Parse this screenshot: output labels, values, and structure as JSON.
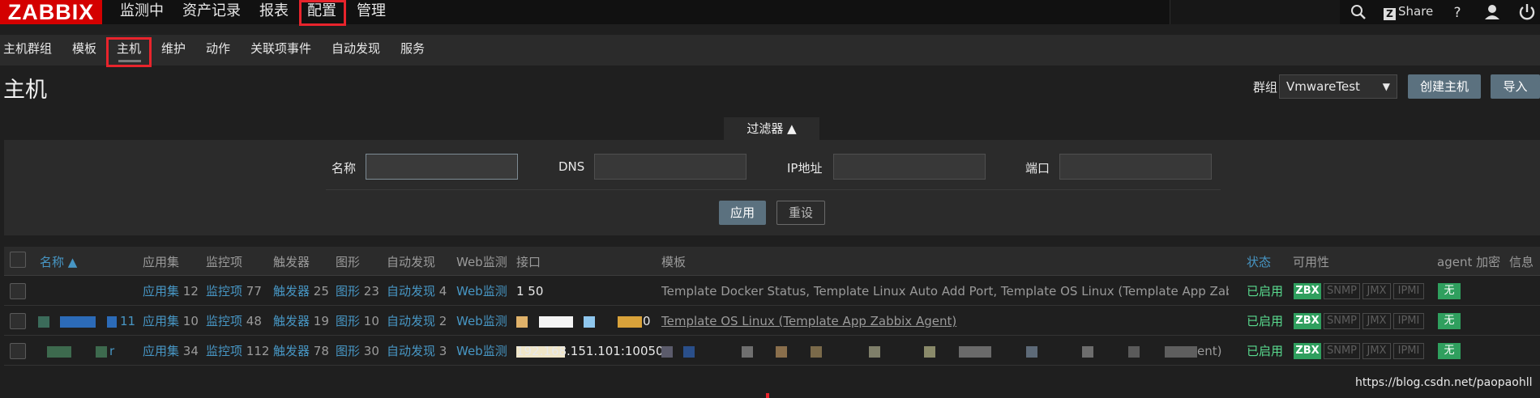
{
  "topbar": {
    "logo": "ZABBIX",
    "menu": [
      "监测中",
      "资产记录",
      "报表",
      "配置",
      "管理"
    ],
    "share_label": "Share",
    "share_box": "Z",
    "icons": [
      "search-icon",
      "help-icon",
      "user-icon",
      "power-icon"
    ]
  },
  "subnav": {
    "items": [
      "主机群组",
      "模板",
      "主机",
      "维护",
      "动作",
      "关联项事件",
      "自动发现",
      "服务"
    ]
  },
  "page": {
    "title": "主机",
    "group_label": "群组",
    "group_value": "VmwareTest",
    "create_button": "创建主机",
    "import_button": "导入"
  },
  "filter": {
    "tab_label": "过滤器 ▲",
    "name_label": "名称",
    "dns_label": "DNS",
    "ip_label": "IP地址",
    "port_label": "端口",
    "apply_button": "应用",
    "reset_button": "重设"
  },
  "table": {
    "headers": {
      "name": "名称 ▲",
      "apps": "应用集",
      "items": "监控项",
      "triggers": "触发器",
      "graphs": "图形",
      "discovery": "自动发现",
      "web": "Web监测",
      "interface": "接口",
      "templates": "模板",
      "status": "状态",
      "availability": "可用性",
      "agent_enc": "agent 加密",
      "info": "信息"
    },
    "rows": [
      {
        "name": "",
        "apps_label": "应用集",
        "apps_count": "12",
        "items_label": "监控项",
        "items_count": "77",
        "triggers_label": "触发器",
        "triggers_count": "25",
        "graphs_label": "图形",
        "graphs_count": "23",
        "discovery_label": "自动发现",
        "discovery_count": "4",
        "web_label": "Web监测",
        "interface": "1                  50",
        "templates": "Template Docker Status, Template Linux Auto Add Port, Template OS Linux (Template App Zabbix Agent)",
        "status": "已启用",
        "zbx": "ZBX",
        "snmp": "SNMP",
        "jmx": "JMX",
        "ipmi": "IPMI",
        "enc": "无"
      },
      {
        "name": "11",
        "apps_label": "应用集",
        "apps_count": "10",
        "items_label": "监控项",
        "items_count": "48",
        "triggers_label": "触发器",
        "triggers_count": "19",
        "graphs_label": "图形",
        "graphs_count": "10",
        "discovery_label": "自动发现",
        "discovery_count": "2",
        "web_label": "Web监测",
        "interface": "0",
        "templates": "Template OS Linux (Template App Zabbix Agent)",
        "status": "已启用",
        "zbx": "ZBX",
        "snmp": "SNMP",
        "jmx": "JMX",
        "ipmi": "IPMI",
        "enc": "无"
      },
      {
        "name": "r",
        "apps_label": "应用集",
        "apps_count": "34",
        "items_label": "监控项",
        "items_count": "112",
        "triggers_label": "触发器",
        "triggers_count": "78",
        "graphs_label": "图形",
        "graphs_count": "30",
        "discovery_label": "自动发现",
        "discovery_count": "3",
        "web_label": "Web监测",
        "interface": "192.168.151.101:10050",
        "templates": "ent)",
        "status": "已启用",
        "zbx": "ZBX",
        "snmp": "SNMP",
        "jmx": "JMX",
        "ipmi": "IPMI",
        "enc": "无"
      }
    ]
  },
  "watermark": "https://blog.csdn.net/paopaohll",
  "colors": {
    "logo_red": "#d40000",
    "highlight_red": "#e8242c",
    "link_blue": "#4796c4",
    "status_green": "#59db8f",
    "zbx_green": "#2f9f5e",
    "button_gray_blue": "#5b717f"
  }
}
